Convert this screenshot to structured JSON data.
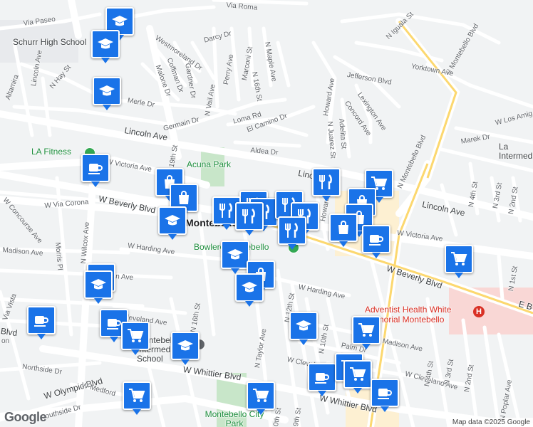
{
  "map": {
    "attribution": "Map data ©2025 Google",
    "logo": "Google",
    "accent_color": "#1a73e8"
  },
  "labels": {
    "via_roma": "Via Roma",
    "via_paseo": "Via Paseo",
    "schurr": "Schurr High School",
    "westmoreland": "Westmoreland Dr",
    "darcy": "Darcy Dr",
    "perry": "Perry Ave",
    "marconi": "Marconi St",
    "n16th_top": "N 16th St",
    "maple": "N Maple Ave",
    "coffman": "Coffman Dr",
    "malone": "Malone Dr",
    "gardner": "Gardner Dr",
    "vail": "N Vail Ave",
    "merle": "Merle Dr",
    "germain": "Germain Dr",
    "loma": "Loma Rd",
    "el_camino": "El Camino Dr",
    "aldea": "Aldea Dr",
    "lincoln_ave_w": "Lincoln Ave",
    "lincoln_ave_mid": "Lincoln Ave",
    "lincoln_ave_e": "Lincoln Ave",
    "lincoln_ave_nw": "Lincoln Ave",
    "n_hay": "N Hay St",
    "altamira": "Altamira",
    "la_fitness": "LA Fitness",
    "victoria_w": "W Victoria Ave",
    "victoria_e": "W Victoria Ave",
    "acuna": "Acuna Park",
    "beverly_w": "W Beverly Blvd",
    "beverly_e": "W Beverly Blvd",
    "via_corona": "W Via Corona",
    "concourse": "W Concourse Ave",
    "morris": "Morris Pl",
    "wilcox": "N Wilcox Ave",
    "madison_w": "Madison Ave",
    "madison_e": "Madison Ave",
    "harding_w": "W Harding Ave",
    "harding_e": "W Harding Ave",
    "montebello": "Montebello",
    "bowlero": "Bowlero Montebello",
    "n12th": "N 12th St",
    "n16th_low": "N 16th St",
    "n19th": "N 19th St",
    "taylor": "N Taylor Ave",
    "cleveland_w": "Cleveland Ave",
    "cleveland_e": "W Cleveland Ave",
    "w_clevel": "W Clevel",
    "palm": "Palm Dr",
    "intermediate": "Montebello Intermediate School",
    "whittier_w": "W Whittier Blvd",
    "whittier_e": "W Whittier Blvd",
    "olympic": "W Olympic Blvd",
    "medford": "W Medford",
    "southside": "Southside Dr",
    "northside": "Northside Dr",
    "montebello_city_park": "Montebello City Park",
    "adventist": "Adventist Health White Memorial Montebello",
    "montebello_blvd": "N Montebello Blvd",
    "montebello_blvd_top": "N Montebello Blvd",
    "n_iguala": "N Iguala St",
    "yorktown": "Yorktown Ave",
    "jefferson": "Jefferson Blvd",
    "lexington": "Lexington Ave",
    "concord": "Concord Ave",
    "adelita": "Adelita St",
    "juarez": "N Juarez St",
    "howard": "Howard Ave",
    "howard_low": "Howard",
    "w_los_amig": "W Los Amig",
    "marek": "Marek Dr",
    "la_intermediate": "La Intermediate",
    "n4th": "N 4th St",
    "n3rd": "N 3rd St",
    "n2nd": "N 2nd St",
    "n1st": "N 1st St",
    "n4th_low": "N 4th St",
    "n3rd_low": "N 3rd St",
    "n2nd_low": "N 2nd St",
    "poplar": "N Poplar Ave",
    "e_b": "E B",
    "n10th": "N 10th St",
    "n9th": "9th St",
    "n10th_low": "0th St",
    "via_vista": "Via Vista",
    "lincoln_ave_left": "Lincoln Ave",
    "bt": "Blvd",
    "on": "on",
    "ison": "ison Ave"
  },
  "markers": [
    {
      "name": "school-marker-schurr-1",
      "icon": "school-icon"
    },
    {
      "name": "school-marker-schurr-2",
      "icon": "school-icon"
    },
    {
      "name": "school-marker-merle",
      "icon": "school-icon"
    },
    {
      "name": "cafe-marker-lafitness",
      "icon": "coffee-icon"
    },
    {
      "name": "shopping-marker-victoria-1",
      "icon": "shopping-bag-icon"
    },
    {
      "name": "shopping-marker-victoria-2",
      "icon": "shopping-bag-icon"
    },
    {
      "name": "school-marker-beverly",
      "icon": "school-icon"
    },
    {
      "name": "restaurant-marker-1",
      "icon": "restaurant-icon"
    },
    {
      "name": "restaurant-marker-2",
      "icon": "restaurant-icon"
    },
    {
      "name": "restaurant-marker-3",
      "icon": "restaurant-icon"
    },
    {
      "name": "restaurant-marker-4",
      "icon": "restaurant-icon"
    },
    {
      "name": "restaurant-marker-5",
      "icon": "restaurant-icon"
    },
    {
      "name": "restaurant-marker-6",
      "icon": "restaurant-icon"
    },
    {
      "name": "restaurant-marker-7",
      "icon": "restaurant-icon"
    },
    {
      "name": "restaurant-marker-lincoln",
      "icon": "restaurant-icon"
    },
    {
      "name": "grocery-marker-lincoln",
      "icon": "shopping-cart-icon"
    },
    {
      "name": "shopping-marker-howard-1",
      "icon": "shopping-bag-icon"
    },
    {
      "name": "shopping-marker-howard-2",
      "icon": "shopping-bag-icon"
    },
    {
      "name": "shopping-marker-howard-3",
      "icon": "shopping-bag-icon"
    },
    {
      "name": "cafe-marker-victoria-e",
      "icon": "coffee-icon"
    },
    {
      "name": "grocery-marker-beverly-e",
      "icon": "shopping-cart-icon"
    },
    {
      "name": "school-marker-harding",
      "icon": "school-icon"
    },
    {
      "name": "shopping-marker-harding",
      "icon": "shopping-bag-icon"
    },
    {
      "name": "school-marker-harding-2",
      "icon": "school-icon"
    },
    {
      "name": "school-marker-madison-1",
      "icon": "school-icon"
    },
    {
      "name": "school-marker-madison-2",
      "icon": "school-icon"
    },
    {
      "name": "cafe-marker-viavista",
      "icon": "coffee-icon"
    },
    {
      "name": "cafe-marker-cleveland",
      "icon": "coffee-icon"
    },
    {
      "name": "grocery-marker-cleveland",
      "icon": "shopping-cart-icon"
    },
    {
      "name": "school-marker-intermediate",
      "icon": "school-icon"
    },
    {
      "name": "school-marker-10th",
      "icon": "school-icon"
    },
    {
      "name": "grocery-marker-madison-e",
      "icon": "shopping-cart-icon"
    },
    {
      "name": "cafe-marker-wclevel",
      "icon": "coffee-icon"
    },
    {
      "name": "grocery-marker-whittier-1",
      "icon": "shopping-cart-icon"
    },
    {
      "name": "grocery-marker-whittier-2",
      "icon": "shopping-cart-icon"
    },
    {
      "name": "cafe-marker-whittier-e",
      "icon": "coffee-icon"
    },
    {
      "name": "grocery-marker-medford",
      "icon": "shopping-cart-icon"
    },
    {
      "name": "grocery-marker-park",
      "icon": "shopping-cart-icon"
    }
  ]
}
